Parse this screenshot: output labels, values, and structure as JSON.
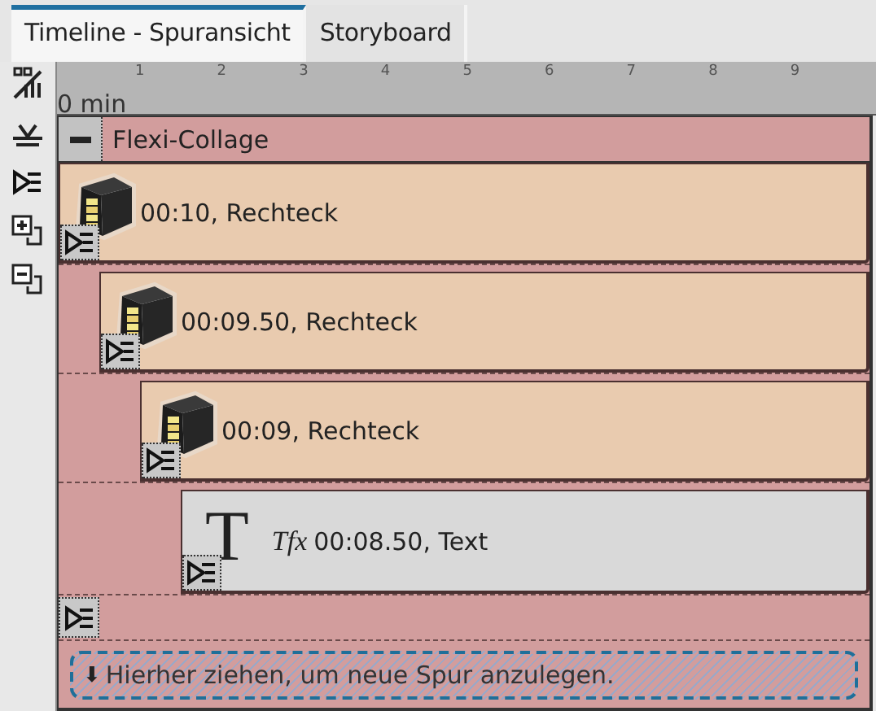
{
  "tabs": [
    {
      "label": "Timeline - Spuransicht",
      "selected": true
    },
    {
      "label": "Storyboard",
      "selected": false
    }
  ],
  "ruler": {
    "start_label": "0 min",
    "ticks": [
      "1",
      "2",
      "3",
      "4",
      "5",
      "6",
      "7",
      "8",
      "9"
    ]
  },
  "collage": {
    "title": "Flexi-Collage",
    "expanded": true,
    "clips": [
      {
        "kind": "shape",
        "label": "00:10, Rechteck"
      },
      {
        "kind": "shape",
        "label": "00:09.50, Rechteck"
      },
      {
        "kind": "shape",
        "label": "00:09, Rechteck"
      },
      {
        "kind": "text",
        "glyph": "T",
        "fx_mark": "Tfx",
        "label": "00:08.50, Text"
      }
    ],
    "drop_zone": {
      "arrow": "⬇",
      "text": "Hierher ziehen, um neue Spur anzulegen."
    }
  }
}
